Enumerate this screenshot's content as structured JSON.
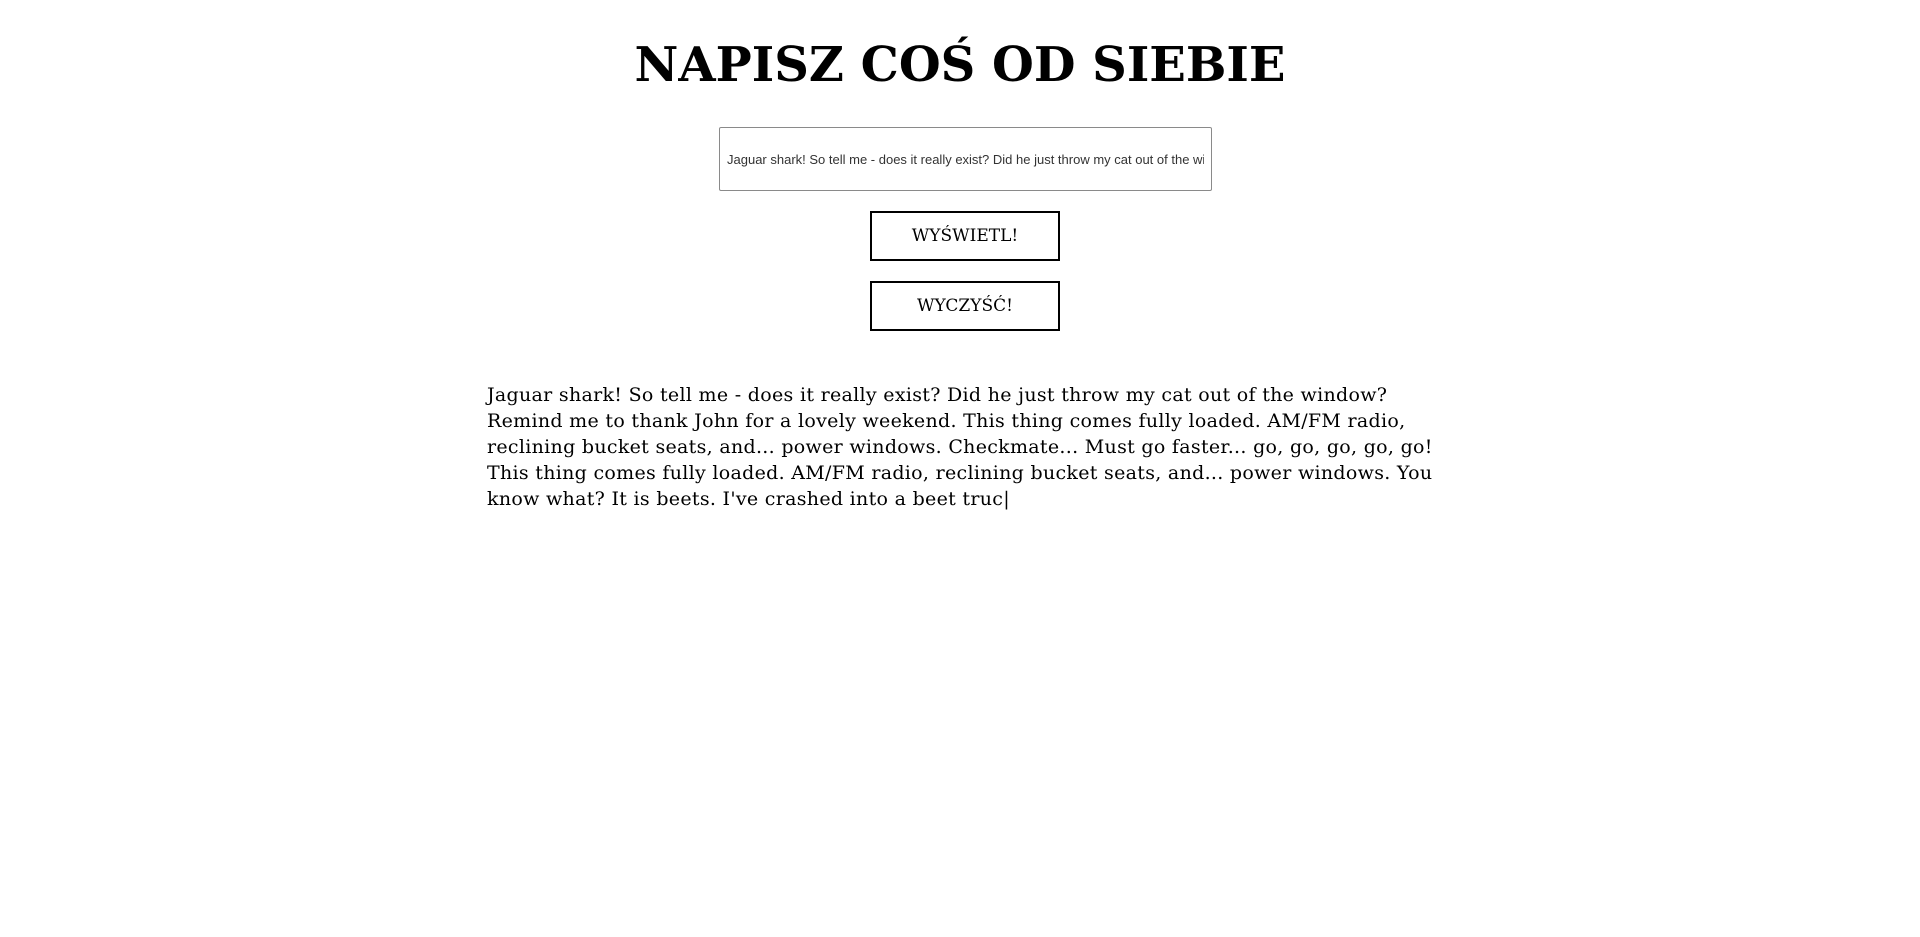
{
  "header": {
    "title": "NAPISZ COŚ OD SIEBIE"
  },
  "input": {
    "value": "Jaguar shark! So tell me - does it really exist? Did he just throw my cat out of the window? Remind me to thank John for a lovely weekend. This thing comes fully loaded. AM/FM radio, reclining bucket seats, and... power windows. Checkmate... Must go faster... go, go, go, go, go! This thing comes fully loaded. AM/FM radio, reclining bucket seats, and... power windows. You know what? It is beets. I've crashed into a beet truc"
  },
  "buttons": {
    "show_label": "WYŚWIETL!",
    "clear_label": "WYCZYŚĆ!"
  },
  "output": {
    "text": "Jaguar shark! So tell me - does it really exist? Did he just throw my cat out of the window? Remind me to thank John for a lovely weekend. This thing comes fully loaded. AM/FM radio, reclining bucket seats, and... power windows. Checkmate... Must go faster... go, go, go, go, go! This thing comes fully loaded. AM/FM radio, reclining bucket seats, and... power windows. You know what? It is beets. I've crashed into a beet truc|"
  }
}
